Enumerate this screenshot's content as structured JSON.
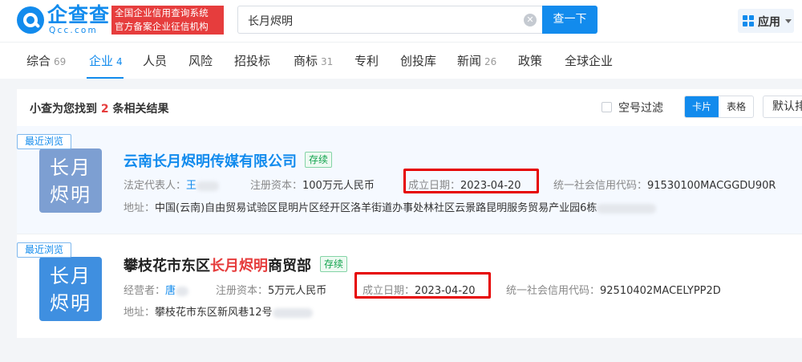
{
  "header": {
    "logo_name": "企查查",
    "logo_domain": "Qcc.com",
    "slogan_line1": "全国企业信用查询系统",
    "slogan_line2": "官方备案企业征信机构",
    "search_value": "长月烬明",
    "search_button": "查一下",
    "apps_label": "应用"
  },
  "tabs": [
    {
      "label": "综合",
      "count": "69"
    },
    {
      "label": "企业",
      "count": "4",
      "active": true
    },
    {
      "label": "人员",
      "count": ""
    },
    {
      "label": "风险",
      "count": ""
    },
    {
      "label": "招投标",
      "count": ""
    },
    {
      "label": "商标",
      "count": "31"
    },
    {
      "label": "专利",
      "count": ""
    },
    {
      "label": "创投库",
      "count": ""
    },
    {
      "label": "新闻",
      "count": "26"
    },
    {
      "label": "政策",
      "count": ""
    },
    {
      "label": "全球企业",
      "count": ""
    }
  ],
  "results": {
    "summary_prefix": "小查为您找到",
    "summary_count": "2",
    "summary_suffix": "条相关结果",
    "filter_label": "空号过滤",
    "view_card": "卡片",
    "view_table": "表格",
    "sort_label": "默认排序"
  },
  "companies": [
    {
      "recent_badge": "最近浏览",
      "avatar_line1": "长月",
      "avatar_line2": "烬明",
      "name": "云南长月烬明传媒有限公司",
      "status": "存续",
      "rep_label": "法定代表人：",
      "rep_value": "王",
      "capital_label": "注册资本：",
      "capital_value": "100万元人民币",
      "date_label": "成立日期：",
      "date_value": "2023-04-20",
      "credit_label": "统一社会信用代码：",
      "credit_value": "91530100MACGGDU90R",
      "address_label": "地址：",
      "address_value": "中国(云南)自由贸易试验区昆明片区经开区洛羊街道办事处林社区云景路昆明服务贸易产业园6栋"
    },
    {
      "recent_badge": "最近浏览",
      "avatar_line1": "长月",
      "avatar_line2": "烬明",
      "name_prefix": "攀枝花市东区",
      "name_highlight": "长月烬明",
      "name_suffix": "商贸部",
      "status": "存续",
      "rep_label": "经营者：",
      "rep_value": "唐",
      "capital_label": "注册资本：",
      "capital_value": "5万元人民币",
      "date_label": "成立日期：",
      "date_value": "2023-04-20",
      "credit_label": "统一社会信用代码：",
      "credit_value": "92510402MACELYPP2D",
      "address_label": "地址：",
      "address_value": "攀枝花市东区新风巷12号"
    }
  ],
  "colors": {
    "brand": "#128bed",
    "highlight": "#e63d3d",
    "status_green": "#10a34c",
    "annotation_red": "#e60000"
  }
}
